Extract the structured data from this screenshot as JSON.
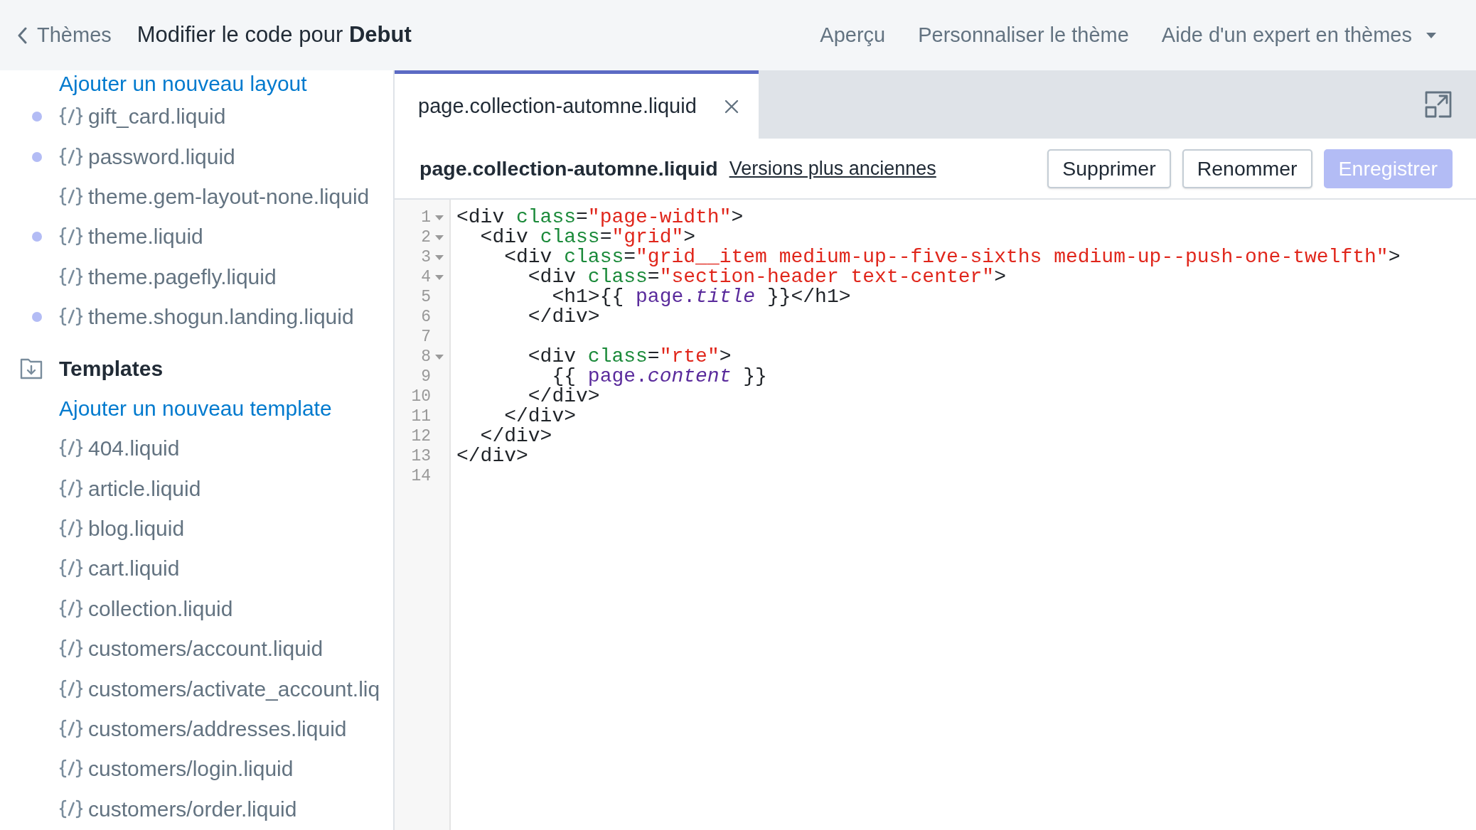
{
  "top_bar": {
    "back_link": "Thèmes",
    "title": "Modifier le code pour **Debut**",
    "links": [
      {
        "kind": "link",
        "label": "Aperçu"
      },
      {
        "kind": "link",
        "label": "Personnaliser le thème"
      },
      {
        "kind": "dropdown",
        "label": "Aide d'un expert en thèmes"
      }
    ]
  },
  "sidebar": {
    "items": [
      {
        "kind": "add_link",
        "label": "Ajouter un nouveau layout"
      },
      {
        "kind": "file",
        "label": "gift_card.liquid",
        "modified": true
      },
      {
        "kind": "file",
        "label": "password.liquid",
        "modified": true
      },
      {
        "kind": "file",
        "label": "theme.gem-layout-none.liquid",
        "modified": false
      },
      {
        "kind": "file",
        "label": "theme.liquid",
        "modified": true
      },
      {
        "kind": "file",
        "label": "theme.pagefly.liquid",
        "modified": false
      },
      {
        "kind": "file",
        "label": "theme.shogun.landing.liquid",
        "modified": true
      },
      {
        "kind": "section",
        "label": "Templates"
      },
      {
        "kind": "add_link",
        "label": "Ajouter un nouveau template"
      },
      {
        "kind": "file",
        "label": "404.liquid",
        "modified": false
      },
      {
        "kind": "file",
        "label": "article.liquid",
        "modified": false
      },
      {
        "kind": "file",
        "label": "blog.liquid",
        "modified": false
      },
      {
        "kind": "file",
        "label": "cart.liquid",
        "modified": false
      },
      {
        "kind": "file",
        "label": "collection.liquid",
        "modified": false
      },
      {
        "kind": "file",
        "label": "customers/account.liquid",
        "modified": false
      },
      {
        "kind": "file",
        "label": "customers/activate_account.liq",
        "modified": false
      },
      {
        "kind": "file",
        "label": "customers/addresses.liquid",
        "modified": false
      },
      {
        "kind": "file",
        "label": "customers/login.liquid",
        "modified": false
      },
      {
        "kind": "file",
        "label": "customers/order.liquid",
        "modified": false
      }
    ]
  },
  "editor": {
    "tabs": [
      {
        "label": "page.collection-automne.liquid",
        "selected": true
      }
    ],
    "file_name": "page.collection-automne.liquid",
    "versions_link": "Versions plus anciennes",
    "buttons": [
      {
        "kind": "secondary",
        "label": "Supprimer",
        "disabled": false
      },
      {
        "kind": "secondary",
        "label": "Renommer",
        "disabled": false
      },
      {
        "kind": "primary",
        "label": "Enregistrer",
        "disabled": true
      }
    ],
    "lines": [
      {
        "number": "1",
        "fold": true,
        "tokens": [
          {
            "kind": "tag",
            "text": "<div "
          },
          {
            "kind": "attr",
            "text": "class"
          },
          {
            "kind": "tag",
            "text": "="
          },
          {
            "kind": "string",
            "text": "\"page-width\""
          },
          {
            "kind": "tag",
            "text": ">"
          }
        ]
      },
      {
        "number": "2",
        "fold": true,
        "tokens": [
          {
            "kind": "tag",
            "text": "  <div "
          },
          {
            "kind": "attr",
            "text": "class"
          },
          {
            "kind": "tag",
            "text": "="
          },
          {
            "kind": "string",
            "text": "\"grid\""
          },
          {
            "kind": "tag",
            "text": ">"
          }
        ]
      },
      {
        "number": "3",
        "fold": true,
        "tokens": [
          {
            "kind": "tag",
            "text": "    <div "
          },
          {
            "kind": "attr",
            "text": "class"
          },
          {
            "kind": "tag",
            "text": "="
          },
          {
            "kind": "string",
            "text": "\"grid__item medium-up--five-sixths medium-up--push-one-twelfth\""
          },
          {
            "kind": "tag",
            "text": ">"
          }
        ]
      },
      {
        "number": "4",
        "fold": true,
        "tokens": [
          {
            "kind": "tag",
            "text": "      <div "
          },
          {
            "kind": "attr",
            "text": "class"
          },
          {
            "kind": "tag",
            "text": "="
          },
          {
            "kind": "string",
            "text": "\"section-header text-center\""
          },
          {
            "kind": "tag",
            "text": ">"
          }
        ]
      },
      {
        "number": "5",
        "fold": false,
        "tokens": [
          {
            "kind": "tag",
            "text": "        <h1>"
          },
          {
            "kind": "plain",
            "text": "{{ "
          },
          {
            "kind": "variable",
            "text": "page."
          },
          {
            "kind": "property",
            "text": "title"
          },
          {
            "kind": "plain",
            "text": " }}"
          },
          {
            "kind": "tag",
            "text": "</h1>"
          }
        ]
      },
      {
        "number": "6",
        "fold": false,
        "tokens": [
          {
            "kind": "tag",
            "text": "      </div>"
          }
        ]
      },
      {
        "number": "7",
        "fold": false
      },
      {
        "number": "8",
        "fold": true,
        "tokens": [
          {
            "kind": "tag",
            "text": "      <div "
          },
          {
            "kind": "attr",
            "text": "class"
          },
          {
            "kind": "tag",
            "text": "="
          },
          {
            "kind": "string",
            "text": "\"rte\""
          },
          {
            "kind": "tag",
            "text": ">"
          }
        ]
      },
      {
        "number": "9",
        "fold": false,
        "tokens": [
          {
            "kind": "plain",
            "text": "        {{ "
          },
          {
            "kind": "variable",
            "text": "page."
          },
          {
            "kind": "property",
            "text": "content"
          },
          {
            "kind": "plain",
            "text": " }}"
          }
        ]
      },
      {
        "number": "10",
        "fold": false,
        "tokens": [
          {
            "kind": "tag",
            "text": "      </div>"
          }
        ]
      },
      {
        "number": "11",
        "fold": false,
        "tokens": [
          {
            "kind": "tag",
            "text": "    </div>"
          }
        ]
      },
      {
        "number": "12",
        "fold": false,
        "tokens": [
          {
            "kind": "tag",
            "text": "  </div>"
          }
        ]
      },
      {
        "number": "13",
        "fold": false,
        "tokens": [
          {
            "kind": "tag",
            "text": "</div>"
          }
        ]
      },
      {
        "number": "14",
        "fold": false
      }
    ]
  }
}
